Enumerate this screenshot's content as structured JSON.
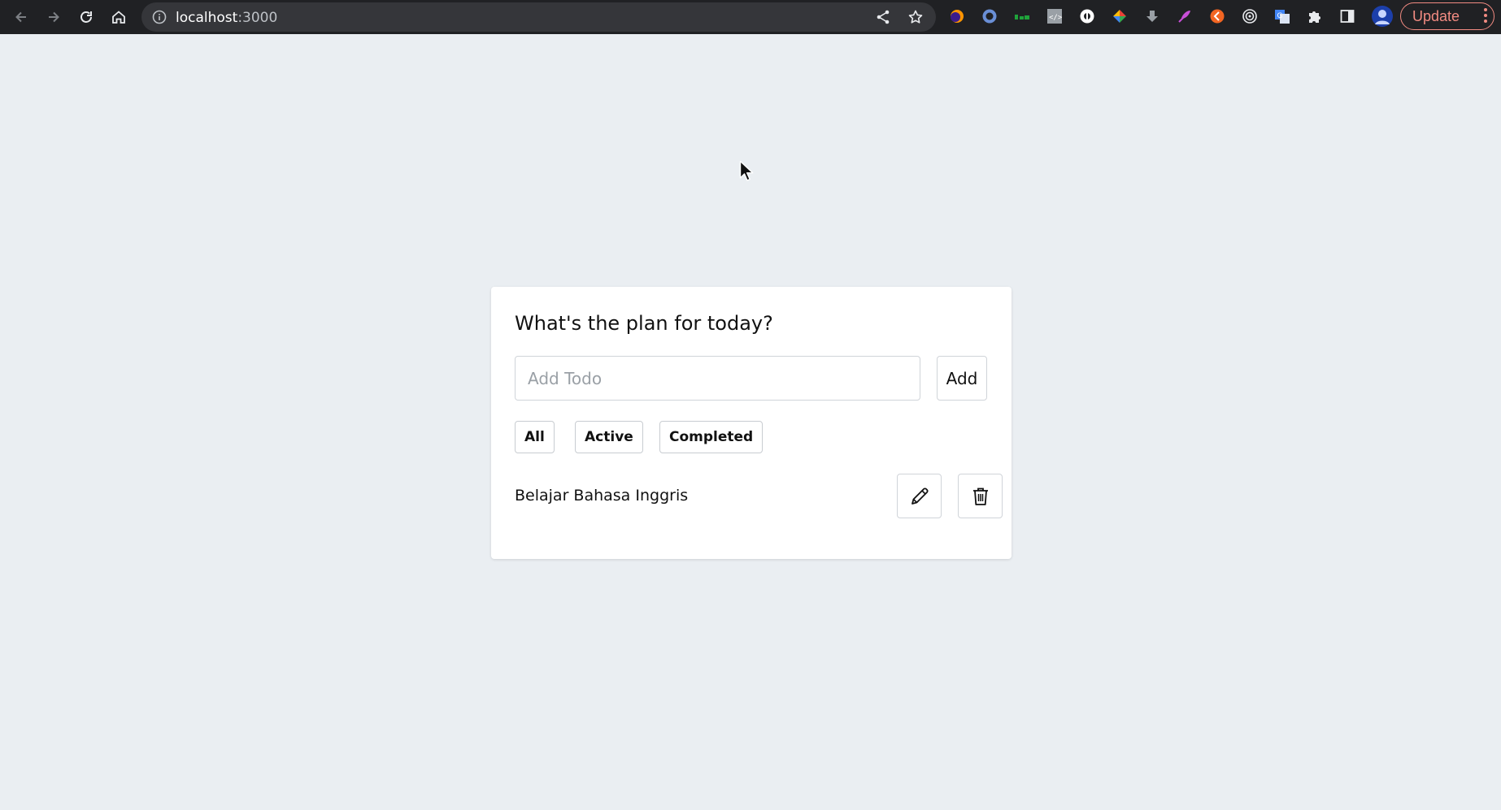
{
  "browser": {
    "url_host": "localhost",
    "url_port": ":3000",
    "update_label": "Update",
    "extensions": [
      "ext-firefox-like-icon",
      "ext-circle-blue-icon",
      "ext-green-icon",
      "ext-code-icon",
      "ext-white-circle-icon",
      "ext-color-wheel-icon",
      "ext-download-icon",
      "ext-feather-icon",
      "ext-orange-icon",
      "ext-target-icon",
      "ext-translate-icon",
      "extensions-puzzle-icon",
      "side-panel-icon",
      "profile-avatar-icon"
    ]
  },
  "app": {
    "title": "What's the plan for today?",
    "input_placeholder": "Add Todo",
    "add_label": "Add",
    "filters": [
      "All",
      "Active",
      "Completed"
    ],
    "todos": [
      {
        "text": "Belajar Bahasa Inggris"
      }
    ]
  }
}
